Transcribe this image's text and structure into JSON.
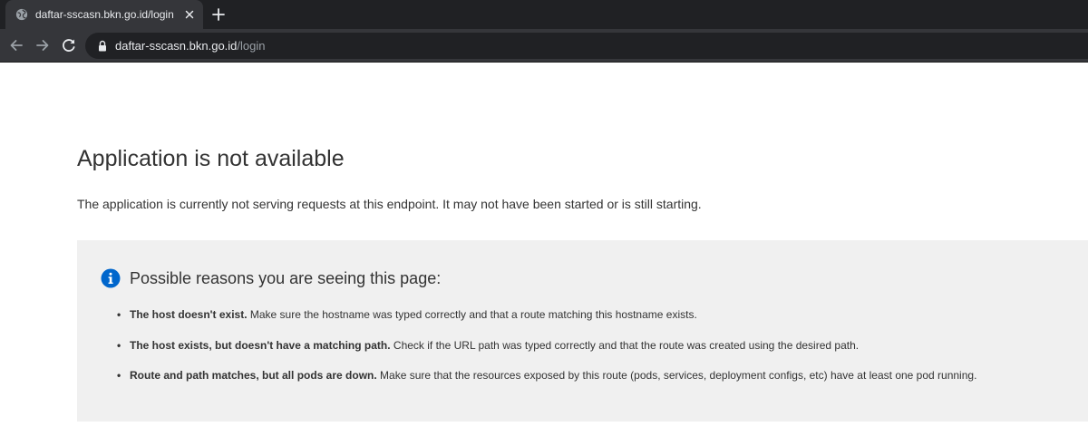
{
  "browser": {
    "tab": {
      "title": "daftar-sscasn.bkn.go.id/login",
      "favicon": "globe-icon",
      "close": "close-icon"
    },
    "new_tab": "plus-icon",
    "nav": {
      "back": "arrow-left-icon",
      "forward": "arrow-right-icon",
      "reload": "reload-icon"
    },
    "address_bar": {
      "lock": "lock-icon",
      "host": "daftar-sscasn.bkn.go.id",
      "path": "/login"
    },
    "colors": {
      "tabstrip": "#202124",
      "toolbar": "#35363a",
      "omnibox": "#202124",
      "url_text": "#e8eaed",
      "url_path": "#9aa0a6"
    }
  },
  "page": {
    "title": "Application is not available",
    "description": "The application is currently not serving requests at this endpoint. It may not have been started or is still starting.",
    "reasons": {
      "icon": "info-icon",
      "heading": "Possible reasons you are seeing this page:",
      "items": [
        {
          "bold": "The host doesn't exist.",
          "text": " Make sure the hostname was typed correctly and that a route matching this hostname exists."
        },
        {
          "bold": "The host exists, but doesn't have a matching path.",
          "text": " Check if the URL path was typed correctly and that the route was created using the desired path."
        },
        {
          "bold": "Route and path matches, but all pods are down.",
          "text": " Make sure that the resources exposed by this route (pods, services, deployment configs, etc) have at least one pod running."
        }
      ]
    },
    "colors": {
      "text": "#333333",
      "panel": "#f0f0f0",
      "info_accent": "#0066cc"
    }
  }
}
